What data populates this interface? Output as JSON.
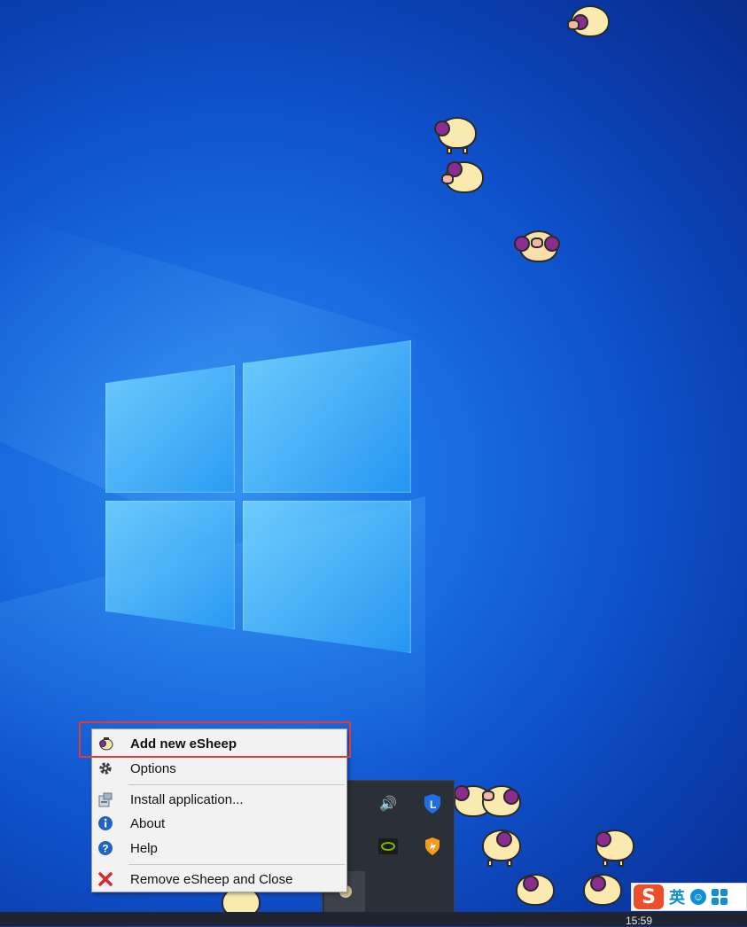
{
  "desktop": {
    "wallpaper": "windows-10-hero",
    "accent_color": "#0f52cc"
  },
  "context_menu": {
    "items": [
      {
        "label": "Add new eSheep",
        "icon": "sheep-icon",
        "bold": true
      },
      {
        "label": "Options",
        "icon": "gear-icon"
      },
      {
        "label": "Install application...",
        "icon": "install-icon"
      },
      {
        "label": "About",
        "icon": "info-icon"
      },
      {
        "label": "Help",
        "icon": "help-icon"
      },
      {
        "label": "Remove eSheep and Close",
        "icon": "close-x-icon"
      }
    ],
    "highlight_color": "#e53935"
  },
  "tray": {
    "icons": [
      "speaker-icon",
      "l-shield-icon",
      "nvidia-icon",
      "orange-shield-icon",
      "sheep-tray-icon"
    ]
  },
  "ime": {
    "logo": "S",
    "mode": "英"
  },
  "taskbar": {
    "clock": "15:59"
  }
}
